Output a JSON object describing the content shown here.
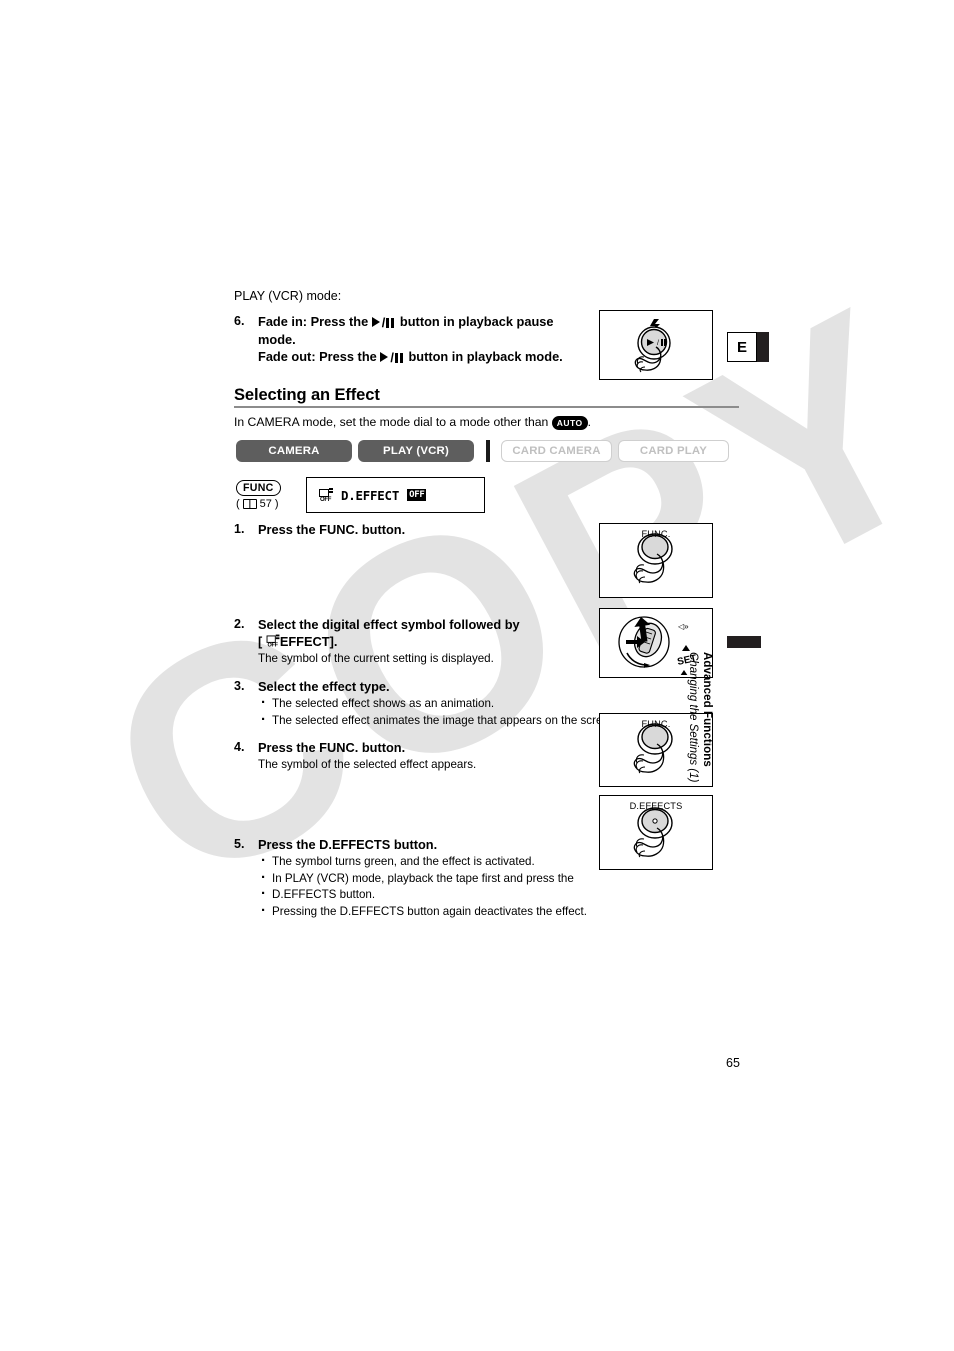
{
  "page": {
    "number": "65",
    "language_tab": "E",
    "watermark": "COPY",
    "side_tab": {
      "title": "Advanced Functions",
      "subtitle": "Changing the Settings (1)"
    }
  },
  "prev_step": {
    "mode_line": "PLAY (VCR) mode:",
    "number": "6.",
    "line1_prefix": "Fade in: Press the",
    "line1_suffix": "button in playback pause",
    "line2": "mode.",
    "line3_prefix": "Fade out: Press the",
    "line3_suffix": "button in playback mode.",
    "illustration_caption": ""
  },
  "section": {
    "heading": "Selecting an Effect",
    "intro_prefix": "In CAMERA mode, set the mode dial to a mode other than",
    "intro_badge": "AUTO",
    "intro_suffix": "."
  },
  "modes": [
    {
      "label": "CAMERA",
      "state": "on"
    },
    {
      "label": "PLAY (VCR)",
      "state": "on"
    },
    {
      "label": "CARD CAMERA",
      "state": "off"
    },
    {
      "label": "CARD PLAY",
      "state": "off"
    }
  ],
  "menu_ref": {
    "func_badge": "FUNC",
    "page_ref": "57",
    "icon_sub": "OFF",
    "item_label": "D.EFFECT",
    "item_value": "OFF"
  },
  "steps": [
    {
      "number": "1.",
      "title": "Press the FUNC. button.",
      "sub": "",
      "bullets": [],
      "illustration_caption": "FUNC."
    },
    {
      "number": "2.",
      "title_line1": "Select the digital effect symbol followed by",
      "title_line2_prefix": "[",
      "title_line2_suffix": "EFFECT].",
      "sub": "The symbol of the current setting is displayed.",
      "bullets": [],
      "illustration_caption": "SET"
    },
    {
      "number": "3.",
      "title": "Select the effect type.",
      "sub": "",
      "bullets": [
        "The selected effect shows as an animation.",
        "The selected effect animates the image that appears on the screen."
      ],
      "illustration_caption": ""
    },
    {
      "number": "4.",
      "title": "Press the FUNC. button.",
      "sub": "The symbol of the selected effect appears.",
      "bullets": [],
      "illustration_caption": "FUNC."
    },
    {
      "number": "5.",
      "title": "Press the D.EFFECTS button.",
      "sub": "",
      "bullets": [
        "The symbol turns green, and the effect is activated.",
        "In PLAY (VCR) mode, playback the tape first and press the",
        "D.EFFECTS button.",
        "Pressing the D.EFFECTS button again deactivates the effect."
      ],
      "illustration_caption": "D.EFFECTS"
    }
  ],
  "illustrations": {
    "playpause_caption": "",
    "joystick_label_set": "SET",
    "deffects_caption": "D.EFFECTS",
    "func_caption": "FUNC."
  },
  "colors": {
    "mode_on_bg": "#5e5e5e",
    "mode_off_border": "#cfcfcf",
    "mode_off_text": "#c0c0c0",
    "rule": "#8c8c8c",
    "watermark": "#e3e3e3",
    "tab_black": "#231f20"
  }
}
